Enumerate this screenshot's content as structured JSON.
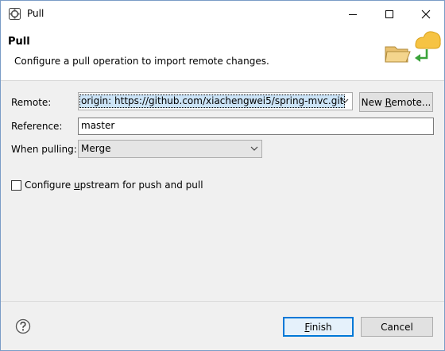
{
  "window": {
    "title": "Pull"
  },
  "banner": {
    "title": "Pull",
    "description": "Configure a pull operation to import remote changes."
  },
  "form": {
    "remote_label": "Remote:",
    "remote_value": "origin: https://github.com/xiachengwei5/spring-mvc.git",
    "new_remote_pre": "New ",
    "new_remote_mn": "R",
    "new_remote_post": "emote...",
    "reference_label": "Reference:",
    "reference_value": "master",
    "when_pulling_label": "When pulling:",
    "when_pulling_value": "Merge",
    "upstream_pre": "Configure ",
    "upstream_mn": "u",
    "upstream_post": "pstream for push and pull",
    "upstream_checked": false
  },
  "footer": {
    "finish_mn": "F",
    "finish_post": "inish",
    "cancel_label": "Cancel"
  },
  "icons": {
    "app": "eclipse-app-icon",
    "banner": "cloud-folder-pull-icon",
    "help": "help-icon"
  },
  "colors": {
    "accent": "#0078d7",
    "selection": "#cce4f7",
    "cloud": "#f6c343",
    "arrow": "#3aa33a"
  }
}
